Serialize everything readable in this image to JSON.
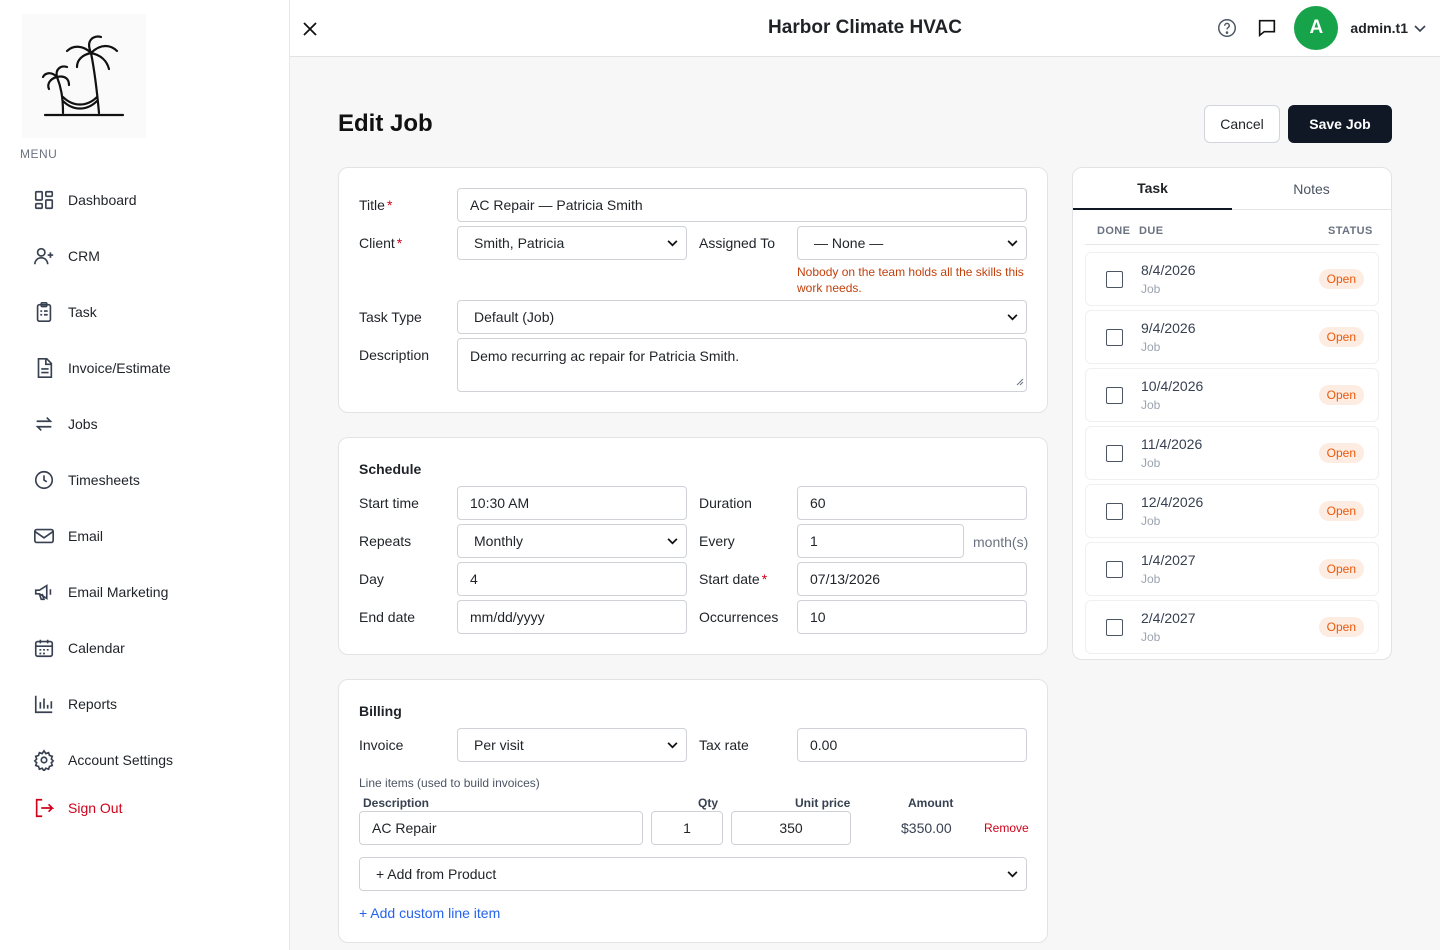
{
  "app": {
    "title": "Harbor Climate HVAC",
    "user": "admin.t1",
    "avatar_letter": "A",
    "avatar_color": "#16a34a"
  },
  "sidebar": {
    "menu_label": "MENU",
    "items": [
      {
        "label": "Dashboard",
        "icon": "dashboard-icon"
      },
      {
        "label": "CRM",
        "icon": "user-plus-icon"
      },
      {
        "label": "Task",
        "icon": "clipboard-icon"
      },
      {
        "label": "Invoice/Estimate",
        "icon": "document-icon"
      },
      {
        "label": "Jobs",
        "icon": "repeat-icon"
      },
      {
        "label": "Timesheets",
        "icon": "clock-icon"
      },
      {
        "label": "Email",
        "icon": "mail-icon"
      },
      {
        "label": "Email Marketing",
        "icon": "megaphone-icon"
      },
      {
        "label": "Calendar",
        "icon": "calendar-icon"
      },
      {
        "label": "Reports",
        "icon": "bar-chart-icon"
      },
      {
        "label": "Account Settings",
        "icon": "gear-icon"
      },
      {
        "label": "Sign Out",
        "icon": "sign-out-icon"
      }
    ]
  },
  "page": {
    "title": "Edit Job",
    "cancel_label": "Cancel",
    "save_label": "Save Job"
  },
  "details": {
    "title_label": "Title",
    "title_value": "AC Repair — Patricia Smith",
    "client_label": "Client",
    "client_value": "Smith, Patricia",
    "assigned_label": "Assigned To",
    "assigned_value": "— None —",
    "assigned_warning": "Nobody on the team holds all the skills this work needs.",
    "task_type_label": "Task Type",
    "task_type_value": "Default (Job)",
    "description_label": "Description",
    "description_value": "Demo recurring ac repair for Patricia Smith."
  },
  "schedule": {
    "heading": "Schedule",
    "start_time_label": "Start time",
    "start_time_value": "10:30 AM",
    "duration_label": "Duration",
    "duration_value": "60",
    "repeats_label": "Repeats",
    "repeats_value": "Monthly",
    "every_label": "Every",
    "every_value": "1",
    "every_unit": "month(s)",
    "day_label": "Day",
    "day_value": "4",
    "start_date_label": "Start date",
    "start_date_value": "07/13/2026",
    "end_date_label": "End date",
    "end_date_placeholder": "mm/dd/yyyy",
    "occurrences_label": "Occurrences",
    "occurrences_value": "10"
  },
  "billing": {
    "heading": "Billing",
    "invoice_label": "Invoice",
    "invoice_value": "Per visit",
    "tax_label": "Tax rate",
    "tax_value": "0.00",
    "line_items_note": "Line items (used to build invoices)",
    "col_description": "Description",
    "col_qty": "Qty",
    "col_unit_price": "Unit price",
    "col_amount": "Amount",
    "line_items": [
      {
        "description": "AC Repair",
        "qty": "1",
        "unit_price": "350",
        "amount": "$350.00",
        "remove": "Remove"
      }
    ],
    "add_from_product": "+ Add from Product",
    "add_custom": "+ Add custom line item"
  },
  "tasks_panel": {
    "tab_task": "Task",
    "tab_notes": "Notes",
    "col_done": "DONE",
    "col_due": "DUE",
    "col_status": "STATUS",
    "rows": [
      {
        "date": "8/4/2026",
        "type": "Job",
        "status": "Open"
      },
      {
        "date": "9/4/2026",
        "type": "Job",
        "status": "Open"
      },
      {
        "date": "10/4/2026",
        "type": "Job",
        "status": "Open"
      },
      {
        "date": "11/4/2026",
        "type": "Job",
        "status": "Open"
      },
      {
        "date": "12/4/2026",
        "type": "Job",
        "status": "Open"
      },
      {
        "date": "1/4/2027",
        "type": "Job",
        "status": "Open"
      },
      {
        "date": "2/4/2027",
        "type": "Job",
        "status": "Open"
      }
    ]
  }
}
